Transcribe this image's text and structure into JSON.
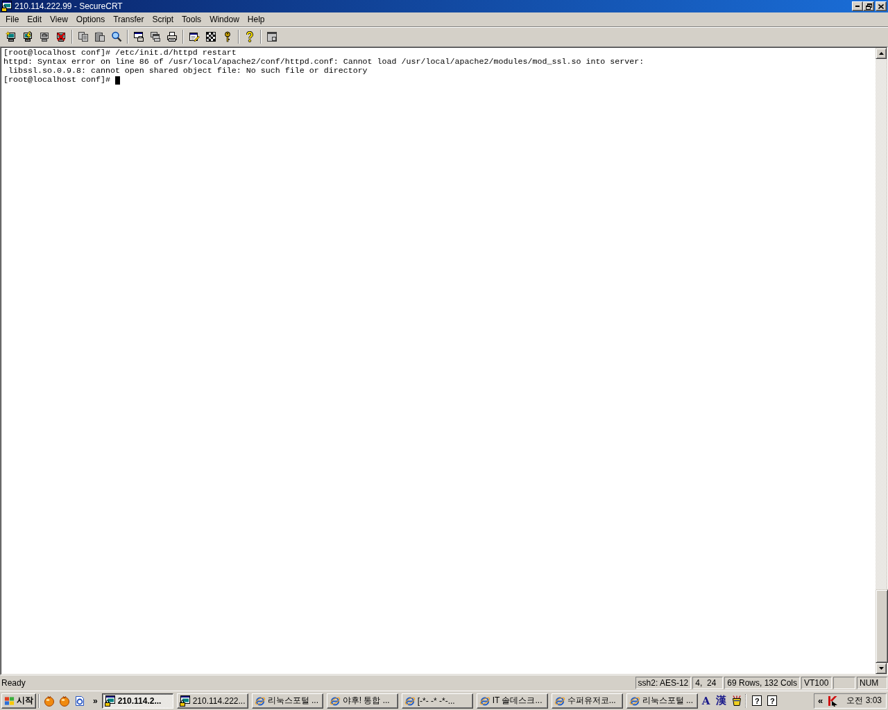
{
  "window": {
    "title": "210.114.222.99 - SecureCRT"
  },
  "menu_bar": {
    "items": [
      "File",
      "Edit",
      "View",
      "Options",
      "Transfer",
      "Script",
      "Tools",
      "Window",
      "Help"
    ]
  },
  "toolbar": {
    "groups": [
      [
        {
          "kind": "connect",
          "disabled": false
        },
        {
          "kind": "quick",
          "disabled": false
        },
        {
          "kind": "reconnect",
          "disabled": true
        },
        {
          "kind": "disconnect",
          "disabled": false
        }
      ],
      [
        {
          "kind": "copy",
          "disabled": true
        },
        {
          "kind": "paste",
          "disabled": true
        },
        {
          "kind": "find",
          "disabled": false
        }
      ],
      [
        {
          "kind": "printscreen",
          "disabled": false
        },
        {
          "kind": "printselection",
          "disabled": true
        },
        {
          "kind": "print",
          "disabled": false
        }
      ],
      [
        {
          "kind": "session",
          "disabled": false
        },
        {
          "kind": "options",
          "disabled": false
        },
        {
          "kind": "key",
          "disabled": false
        }
      ],
      [
        {
          "kind": "help",
          "disabled": false
        }
      ],
      [
        {
          "kind": "tile",
          "disabled": true
        }
      ]
    ]
  },
  "terminal": {
    "lines": [
      "[root@localhost conf]# /etc/init.d/httpd restart",
      "httpd: Syntax error on line 86 of /usr/local/apache2/conf/httpd.conf: Cannot load /usr/local/apache2/modules/mod_ssl.so into server:",
      " libssl.so.0.9.8: cannot open shared object file: No such file or directory",
      "[root@localhost conf]#"
    ],
    "cursor": true
  },
  "status_bar": {
    "message": "Ready",
    "panels": [
      {
        "kind": "text",
        "text": "ssh2: AES-12"
      },
      {
        "kind": "text",
        "text": "4,  24"
      },
      {
        "kind": "text",
        "text": "69 Rows, 132 Cols"
      },
      {
        "kind": "text",
        "text": "VT100"
      },
      {
        "kind": "empty"
      },
      {
        "kind": "text",
        "text": "NUM"
      }
    ]
  },
  "taskbar": {
    "start": "시작",
    "quick_launch": [
      {
        "kind": "ball"
      },
      {
        "kind": "ball"
      },
      {
        "kind": "page"
      }
    ],
    "more": "»",
    "tasks": [
      {
        "kind": "terminal",
        "label": "210.114.2...",
        "selected": true
      },
      {
        "kind": "terminal",
        "label": "210.114.222...",
        "selected": false
      },
      {
        "kind": "browser",
        "label": "리눅스포털 ...",
        "selected": false
      },
      {
        "kind": "browser",
        "label": "야후! 통합 ...",
        "selected": false
      },
      {
        "kind": "browser",
        "label": "[-*- -* -*-...",
        "selected": false
      },
      {
        "kind": "browser",
        "label": "IT 솔데스크...",
        "selected": false
      },
      {
        "kind": "browser",
        "label": "수퍼유저코...",
        "selected": false
      },
      {
        "kind": "browser",
        "label": "리눅스포털 ...",
        "selected": false
      }
    ],
    "ime": [
      "A",
      "漢"
    ],
    "help_icons": [
      "?",
      "?"
    ],
    "tray": {
      "expand": "«",
      "clock": "오전 3:03"
    }
  }
}
